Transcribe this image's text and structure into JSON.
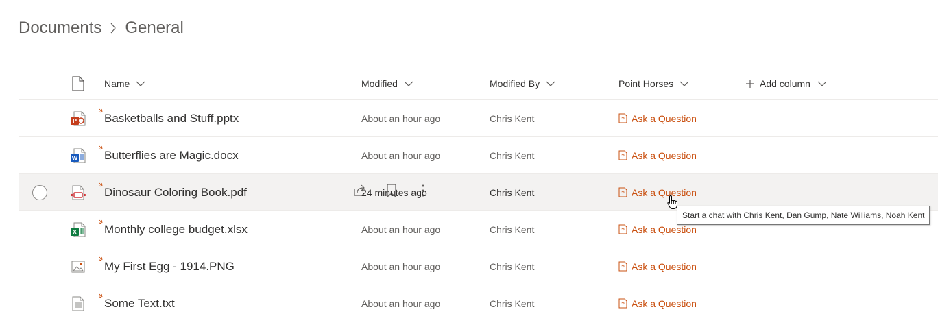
{
  "breadcrumb": {
    "root": "Documents",
    "current": "General"
  },
  "columns": {
    "name": "Name",
    "modified": "Modified",
    "modified_by": "Modified By",
    "point_horses": "Point Horses",
    "add_column": "Add column"
  },
  "rows": [
    {
      "name": "Basketballs and Stuff.pptx",
      "modified": "About an hour ago",
      "modified_by": "Chris Kent",
      "action": "Ask a Question",
      "icon": "powerpoint-file-icon"
    },
    {
      "name": "Butterflies are Magic.docx",
      "modified": "About an hour ago",
      "modified_by": "Chris Kent",
      "action": "Ask a Question",
      "icon": "word-file-icon"
    },
    {
      "name": "Dinosaur Coloring Book.pdf",
      "modified": "24 minutes ago",
      "modified_by": "Chris Kent",
      "action": "Ask a Question",
      "icon": "pdf-file-icon"
    },
    {
      "name": "Monthly college budget.xlsx",
      "modified": "About an hour ago",
      "modified_by": "Chris Kent",
      "action": "Ask a Question",
      "icon": "excel-file-icon"
    },
    {
      "name": "My First Egg - 1914.PNG",
      "modified": "About an hour ago",
      "modified_by": "Chris Kent",
      "action": "Ask a Question",
      "icon": "image-file-icon"
    },
    {
      "name": "Some Text.txt",
      "modified": "About an hour ago",
      "modified_by": "Chris Kent",
      "action": "Ask a Question",
      "icon": "text-file-icon"
    }
  ],
  "tooltip": "Start a chat with Chris Kent, Dan Gump, Nate Williams, Noah Kent",
  "colors": {
    "accent": "#ca5010",
    "selected_row": "#f3f2f1",
    "powerpoint": "#c43e1c",
    "word": "#185abd",
    "excel": "#107c41",
    "pdf": "#d13438"
  }
}
